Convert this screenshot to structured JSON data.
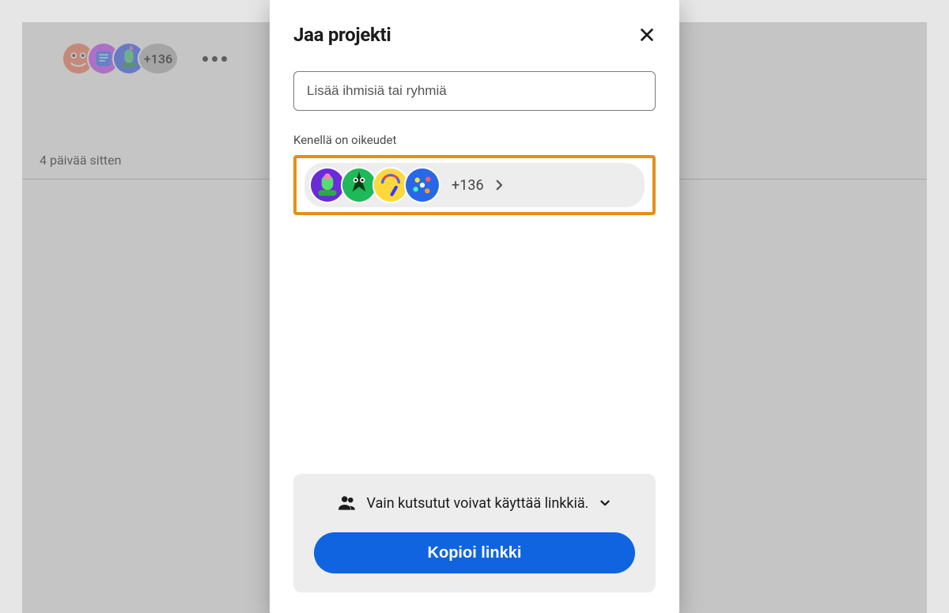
{
  "header": {
    "count_badge": "+136",
    "timestamp": "4 päivää sitten"
  },
  "modal": {
    "title": "Jaa projekti",
    "add_people_placeholder": "Lisää ihmisiä tai ryhmiä",
    "who_has_access_label": "Kenellä on oikeudet",
    "access_count": "+136",
    "link_permission_text": "Vain kutsutut voivat käyttää linkkiä.",
    "copy_link_label": "Kopioi linkki"
  }
}
